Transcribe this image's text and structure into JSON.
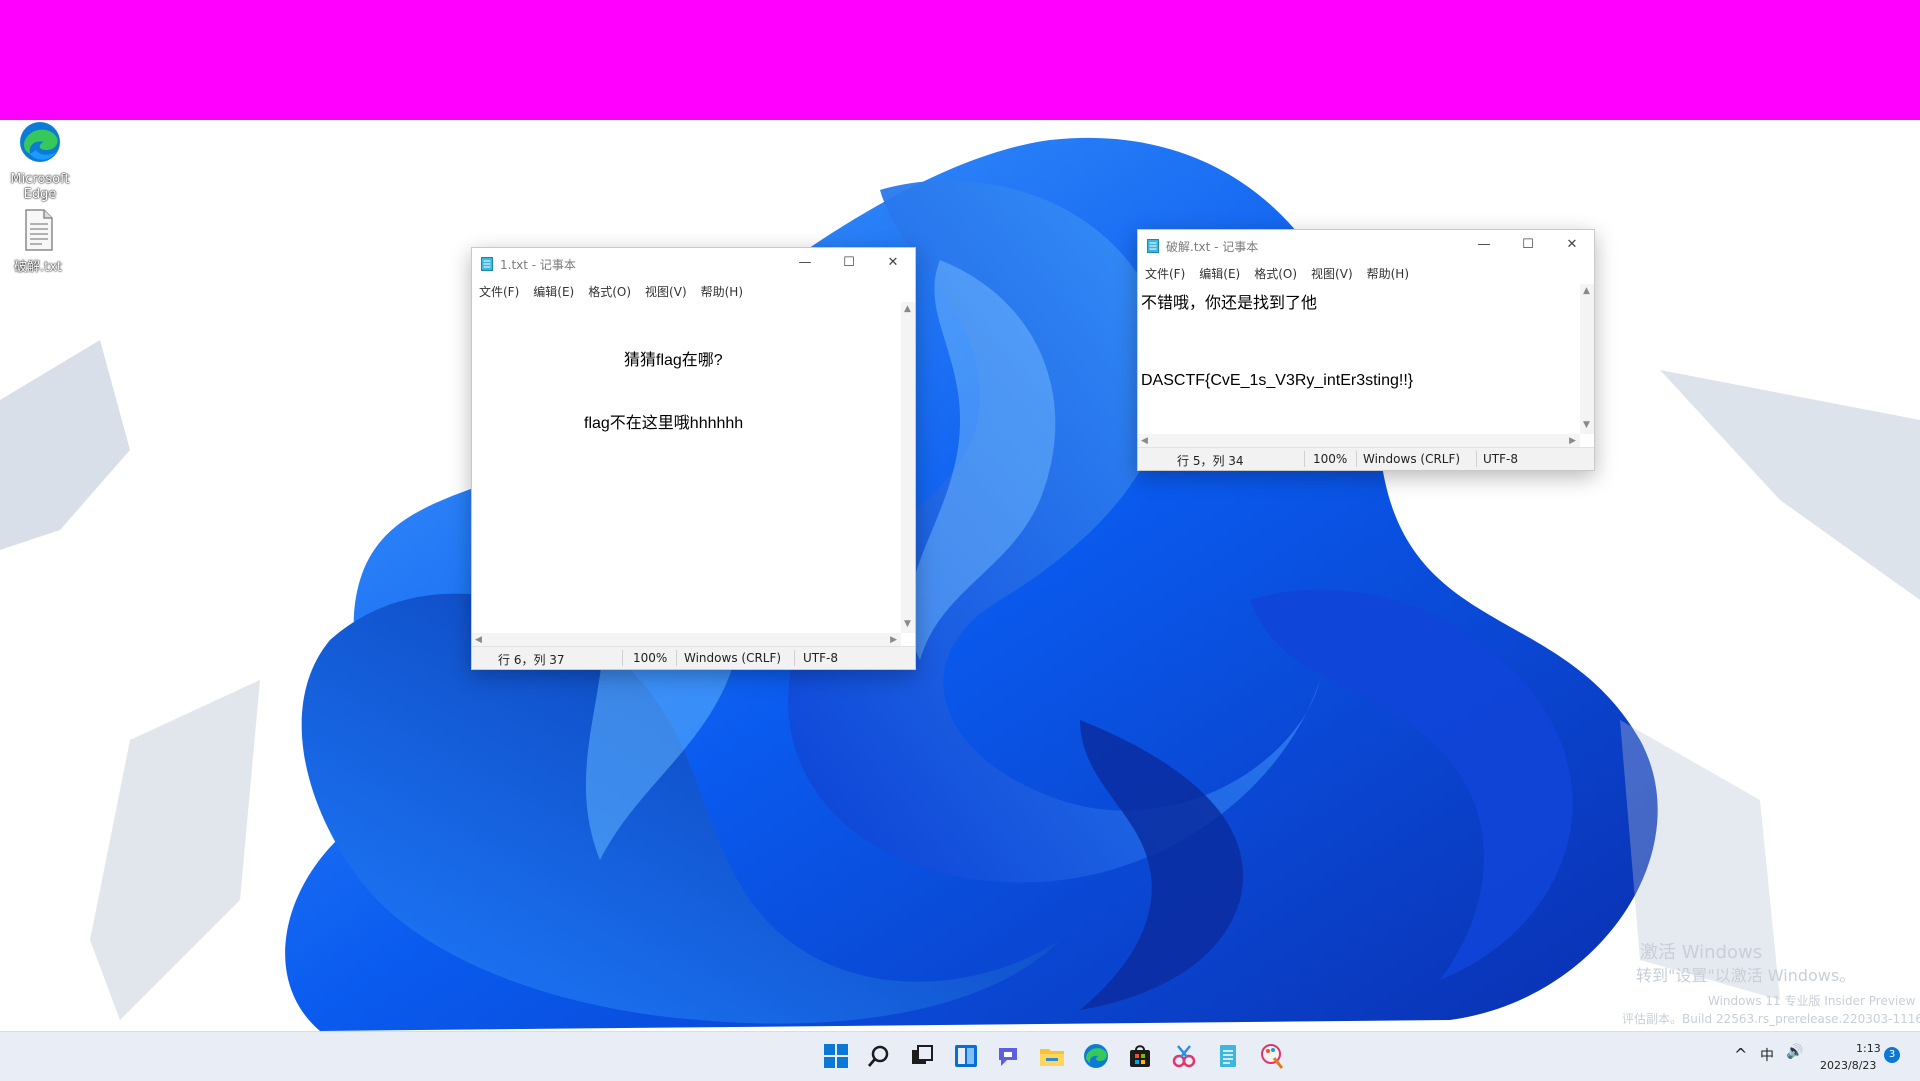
{
  "colors": {
    "top_bar": "#ff00ff",
    "taskbar": "#e9eef6",
    "accent": "#0067c0"
  },
  "desktop_icons": [
    {
      "label_line1": "Microsoft",
      "label_line2": "Edge",
      "icon": "edge-icon"
    },
    {
      "label": "破解.txt",
      "icon": "text-file-icon"
    }
  ],
  "notepad_left": {
    "title": "1.txt - 记事本",
    "menus": [
      "文件(F)",
      "编辑(E)",
      "格式(O)",
      "视图(V)",
      "帮助(H)"
    ],
    "lines": [
      "猜猜flag在哪?",
      "flag不在这里哦hhhhhh"
    ],
    "status": {
      "position": "行 6，列 37",
      "zoom": "100%",
      "line_ending": "Windows (CRLF)",
      "encoding": "UTF-8"
    }
  },
  "notepad_right": {
    "title": "破解.txt - 记事本",
    "menus": [
      "文件(F)",
      "编辑(E)",
      "格式(O)",
      "视图(V)",
      "帮助(H)"
    ],
    "lines": [
      "不错哦，你还是找到了他",
      "DASCTF{CvE_1s_V3Ry_intEr3sting!!}"
    ],
    "status": {
      "position": "行 5，列 34",
      "zoom": "100%",
      "line_ending": "Windows (CRLF)",
      "encoding": "UTF-8"
    }
  },
  "window_controls": {
    "minimize": "—",
    "maximize": "☐",
    "close": "✕"
  },
  "watermark": {
    "line1": "激活 Windows",
    "line2": "转到\"设置\"以激活 Windows。",
    "line3": "Windows 11 专业版 Insider Preview",
    "line4": "评估副本。Build 22563.rs_prerelease.220303-1116"
  },
  "taskbar": {
    "icons": [
      "start-icon",
      "search-icon",
      "task-view-icon",
      "widgets-icon",
      "chat-icon",
      "file-explorer-icon",
      "edge-icon",
      "store-icon",
      "snipping-tool-icon",
      "notepad-icon",
      "paint-icon"
    ],
    "tray": {
      "chevron": "^",
      "ime": "中",
      "volume": "🔊",
      "time": "1:13",
      "date": "2023/8/23",
      "notification_count": "3"
    }
  }
}
